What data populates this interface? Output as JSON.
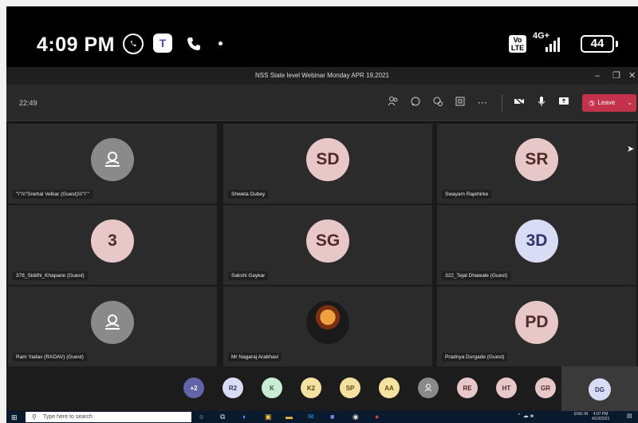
{
  "status_bar": {
    "time": "4:09 PM",
    "volte": "Vo LTE",
    "network": "4G+",
    "battery": "44"
  },
  "window": {
    "title": "NSS State level Webinar Monday APR 19,2021",
    "minimize": "–",
    "maximize": "❐",
    "close": "✕"
  },
  "toolbar": {
    "call_duration": "22:49",
    "leave_label": "Leave"
  },
  "participants": [
    {
      "name": "\"\\\"\\\\\\\"Snehal Velkar (Guest)\\\\\\\"\\\"\"",
      "initials": "",
      "style": "grey"
    },
    {
      "name": "Shweta Dubey",
      "initials": "SD",
      "style": "pink"
    },
    {
      "name": "Swayam Rajehirke",
      "initials": "SR",
      "style": "pink"
    },
    {
      "name": "378_Siddhi_Khapane (Guest)",
      "initials": "3",
      "style": "pink"
    },
    {
      "name": "Sakshi Gaykar",
      "initials": "SG",
      "style": "pink"
    },
    {
      "name": "322_Tejal Dhawale (Guest)",
      "initials": "3D",
      "style": "blue"
    },
    {
      "name": "Ram Yadav (RADAV) (Guest)",
      "initials": "",
      "style": "grey"
    },
    {
      "name": "Mr Nagaraj Arabhavi",
      "initials": "",
      "style": "photo"
    },
    {
      "name": "Pradnya Durgade (Guest)",
      "initials": "PD",
      "style": "pink"
    }
  ],
  "strip": [
    {
      "label": "+2",
      "color": "#6264a7",
      "text": "#ffffff"
    },
    {
      "label": "R2",
      "color": "#d8dcf4",
      "text": "#35356a"
    },
    {
      "label": "K",
      "color": "#c8ecd4",
      "text": "#2f5a3a"
    },
    {
      "label": "K2",
      "color": "#f6e2a0",
      "text": "#5a4a10"
    },
    {
      "label": "SP",
      "color": "#f6e2a0",
      "text": "#5a4a10"
    },
    {
      "label": "AA",
      "color": "#f6e2a0",
      "text": "#5a4a10"
    },
    {
      "label": "",
      "color": "#8a8a8a",
      "text": "#ffffff"
    },
    {
      "label": "RE",
      "color": "#e7c7c7",
      "text": "#4f2b2b"
    },
    {
      "label": "HT",
      "color": "#e7c7c7",
      "text": "#4f2b2b"
    },
    {
      "label": "GR",
      "color": "#e7c7c7",
      "text": "#4f2b2b"
    }
  ],
  "self_view": {
    "initials": "DG"
  },
  "taskbar": {
    "search_placeholder": "Type here to search",
    "lang": "ENG IN",
    "clock_time": "4:07 PM",
    "clock_date": "4/19/2021"
  }
}
